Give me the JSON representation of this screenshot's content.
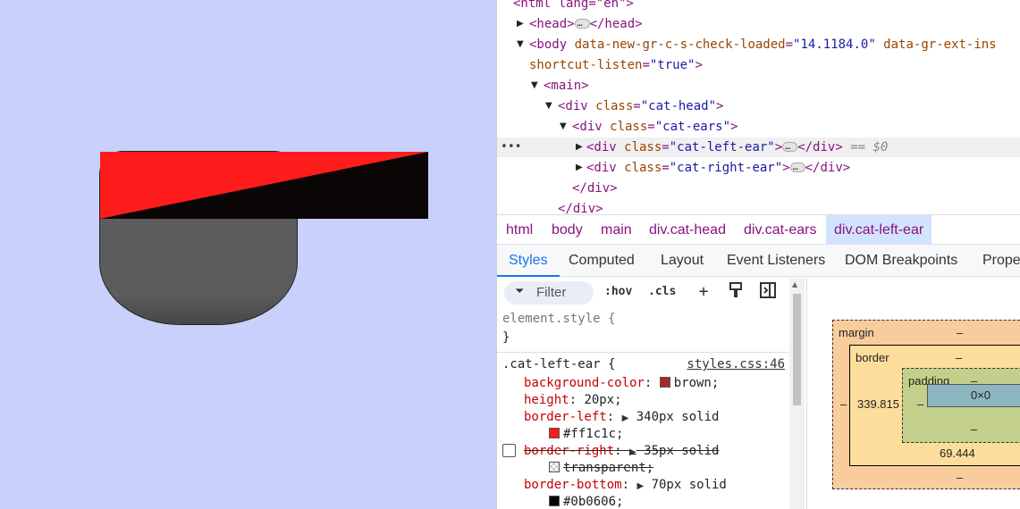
{
  "colors": {
    "preview_bg": "#c8d0fc",
    "ear_left": "#ff1c1c",
    "ear_bottom": "#0b0606",
    "face": "#5c5c5c",
    "selected_breadcrumb": "#d3e3fd",
    "active_tab": "#1a73e8"
  },
  "dom_tree": {
    "html_line": "<html lang=\"en\">",
    "head_open": "<head>",
    "head_close": "</head>",
    "body_tag": "<body",
    "body_attr1_name": " data-new-gr-c-s-check-loaded",
    "body_attr1_val": "\"14.1184.0\"",
    "body_attr2_name": " data-gr-ext-ins",
    "body_attr3_name": "shortcut-listen",
    "body_attr3_val": "\"true\"",
    "main_open": "<main>",
    "cat_head_class": "\"cat-head\"",
    "cat_ears_class": "\"cat-ears\"",
    "cat_left_ear_class": "\"cat-left-ear\"",
    "cat_right_ear_class": "\"cat-right-ear\"",
    "div_open": "<div",
    "class_attr": " class",
    "gt": ">",
    "div_close": "</div>",
    "div_close_partial": "</div>",
    "eq_dollar": "== $0",
    "gutter_dots": "•••"
  },
  "breadcrumbs": [
    "html",
    "body",
    "main",
    "div.cat-head",
    "div.cat-ears",
    "div.cat-left-ear"
  ],
  "tabs": [
    "Styles",
    "Computed",
    "Layout",
    "Event Listeners",
    "DOM Breakpoints",
    "Prope"
  ],
  "toolbar": {
    "filter_placeholder": "Filter",
    "hov": ":hov",
    "cls": ".cls"
  },
  "styles": {
    "element_style": "element.style {",
    "close_brace": "}",
    "selector": ".cat-left-ear {",
    "source": "styles.css:46",
    "props": [
      {
        "name": "background-color",
        "value": "brown;"
      },
      {
        "name": "height",
        "value": "20px;"
      },
      {
        "name": "border-left",
        "value": "340px solid"
      },
      {
        "name": "",
        "value": "#ff1c1c;"
      },
      {
        "name": "border-right",
        "value": "35px solid"
      },
      {
        "name": "",
        "value": "transparent;"
      },
      {
        "name": "border-bottom",
        "value": "70px solid"
      },
      {
        "name": "",
        "value": "#0b0606;"
      }
    ]
  },
  "box_model": {
    "margin_label": "margin",
    "margin_top": "–",
    "margin_bottom": "–",
    "margin_left": "–",
    "border_label": "border",
    "border_top": "–",
    "border_left": "339.815",
    "border_bottom": "69.444",
    "padding_label": "padding",
    "padding_top": "–",
    "padding_bottom": "–",
    "padding_left": "–",
    "content": "0×0"
  }
}
